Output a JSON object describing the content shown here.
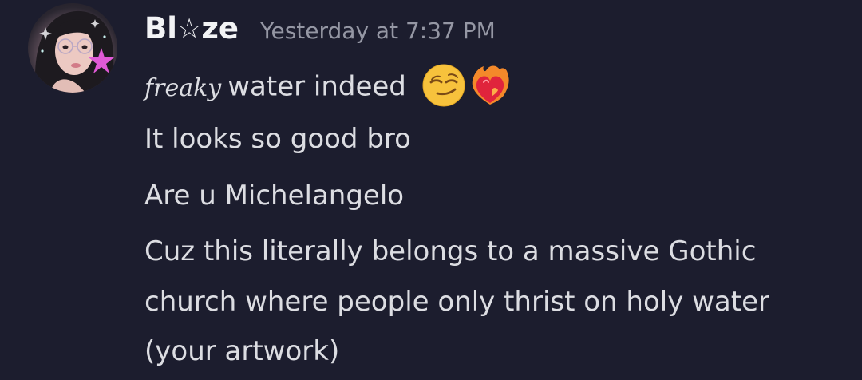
{
  "message": {
    "author": {
      "name_prefix": "Bl",
      "name_star": "☆",
      "name_suffix": "ze",
      "avatar_icon": "avatar-image"
    },
    "timestamp": "Yesterday at 7:37 PM",
    "lines": [
      {
        "styled_prefix": "freaky",
        "text": "water indeed",
        "emojis": [
          "smirking-face-icon",
          "heart-on-fire-icon"
        ]
      },
      {
        "text": "It looks so good bro"
      },
      {
        "text": "Are u Michelangelo"
      },
      {
        "text": "Cuz this literally belongs to a massive Gothic"
      },
      {
        "text": "church where people only thrist on holy water"
      },
      {
        "text": "(your artwork)"
      }
    ]
  },
  "colors": {
    "background": "#1c1d2e",
    "username": "#f2f3f5",
    "timestamp": "#9597a4",
    "message_text": "#dcdde2"
  }
}
